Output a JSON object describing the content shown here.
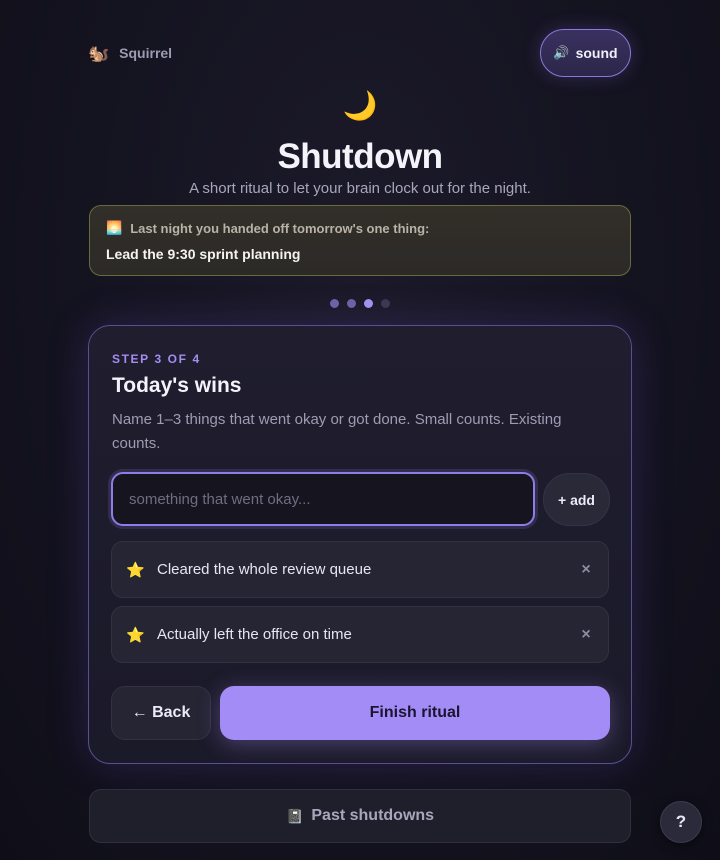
{
  "header": {
    "brand_icon": "🐿️",
    "brand_name": "Squirrel",
    "sound_icon": "🔊",
    "sound_label": "sound"
  },
  "hero": {
    "moon_icon": "🌙",
    "title": "Shutdown",
    "subtitle": "A short ritual to let your brain clock out for the night."
  },
  "handoff": {
    "icon": "🌅",
    "label": "Last night you handed off tomorrow's one thing:",
    "value": "Lead the 9:30 sprint planning"
  },
  "progress": {
    "total_steps": 4,
    "current_step": 3
  },
  "step": {
    "label": "STEP 3 OF 4",
    "title": "Today's wins",
    "description": "Name 1–3 things that went okay or got done. Small counts. Existing counts.",
    "input_value": "",
    "input_placeholder": "something that went okay...",
    "add_label": "+ add",
    "wins": [
      {
        "icon": "⭐",
        "text": "Cleared the whole review queue",
        "remove": "×"
      },
      {
        "icon": "⭐",
        "text": "Actually left the office on time",
        "remove": "×"
      }
    ],
    "back_label": "← Back",
    "finish_label": "Finish ritual"
  },
  "footer": {
    "past_icon": "📓",
    "past_label": "Past shutdowns",
    "help_label": "?"
  },
  "colors": {
    "accent": "#a48cf7",
    "accent_border": "#8f7ce6",
    "handoff_border": "#6b6a3c",
    "background": "#141320"
  }
}
